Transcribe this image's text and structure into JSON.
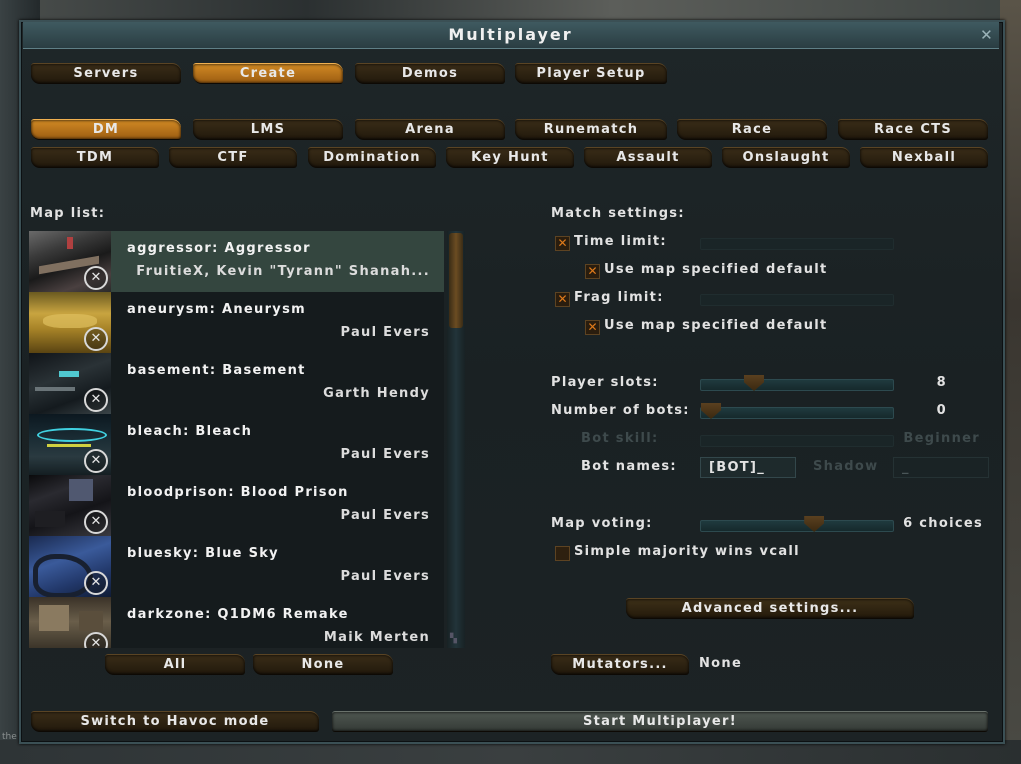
{
  "window": {
    "title": "Multiplayer",
    "close_icon": "close-icon"
  },
  "background": {
    "bottom_text": "the"
  },
  "top_tabs": [
    {
      "label": "Servers",
      "active": false
    },
    {
      "label": "Create",
      "active": true
    },
    {
      "label": "Demos",
      "active": false
    },
    {
      "label": "Player Setup",
      "active": false
    }
  ],
  "gametypes_row1": [
    {
      "label": "DM",
      "active": true
    },
    {
      "label": "LMS",
      "active": false
    },
    {
      "label": "Arena",
      "active": false
    },
    {
      "label": "Runematch",
      "active": false
    },
    {
      "label": "Race",
      "active": false
    },
    {
      "label": "Race CTS",
      "active": false
    }
  ],
  "gametypes_row2": [
    {
      "label": "TDM"
    },
    {
      "label": "CTF"
    },
    {
      "label": "Domination"
    },
    {
      "label": "Key Hunt"
    },
    {
      "label": "Assault"
    },
    {
      "label": "Onslaught"
    },
    {
      "label": "Nexball"
    }
  ],
  "map_list": {
    "heading": "Map list:",
    "maps": [
      {
        "title": "aggressor: Aggressor",
        "author": "FruitieX, Kevin \"Tyrann\" Shanah...",
        "selected": true
      },
      {
        "title": "aneurysm: Aneurysm",
        "author": "Paul Evers",
        "selected": false
      },
      {
        "title": "basement: Basement",
        "author": "Garth Hendy",
        "selected": false
      },
      {
        "title": "bleach: Bleach",
        "author": "Paul Evers",
        "selected": false
      },
      {
        "title": "bloodprison: Blood Prison",
        "author": "Paul Evers",
        "selected": false
      },
      {
        "title": "bluesky: Blue Sky",
        "author": "Paul Evers",
        "selected": false
      },
      {
        "title": "darkzone: Q1DM6 Remake",
        "author": "Maik Merten",
        "selected": false
      }
    ],
    "all_label": "All",
    "none_label": "None"
  },
  "match": {
    "heading": "Match settings:",
    "time_limit": {
      "label": "Time limit:",
      "checked": true
    },
    "time_default": {
      "label": "Use map specified default",
      "checked": true
    },
    "frag_limit": {
      "label": "Frag limit:",
      "checked": true
    },
    "frag_default": {
      "label": "Use map specified default",
      "checked": true
    },
    "player_slots": {
      "label": "Player slots:",
      "value": "8",
      "level": 0.25
    },
    "bots": {
      "label": "Number of bots:",
      "value": "0",
      "level": 0.0
    },
    "bot_skill": {
      "label": "Bot skill:",
      "value": "Beginner",
      "level": 0.0,
      "enabled": false
    },
    "bot_names": {
      "label": "Bot names:",
      "prefix": "[BOT]_",
      "shadow_label": "Shadow",
      "suffix": "_"
    },
    "map_voting": {
      "label": "Map voting:",
      "value": "6 choices",
      "level": 0.6
    },
    "majority": {
      "label": "Simple majority wins vcall",
      "checked": false
    },
    "advanced_label": "Advanced settings...",
    "mutators_label": "Mutators...",
    "mutators_value": "None"
  },
  "footer": {
    "havoc_label": "Switch to Havoc mode",
    "start_label": "Start Multiplayer!"
  },
  "colors": {
    "accent_orange": "#d28a24",
    "selected_row": "#34463f",
    "checkbox_mark": "#e07a1a"
  }
}
